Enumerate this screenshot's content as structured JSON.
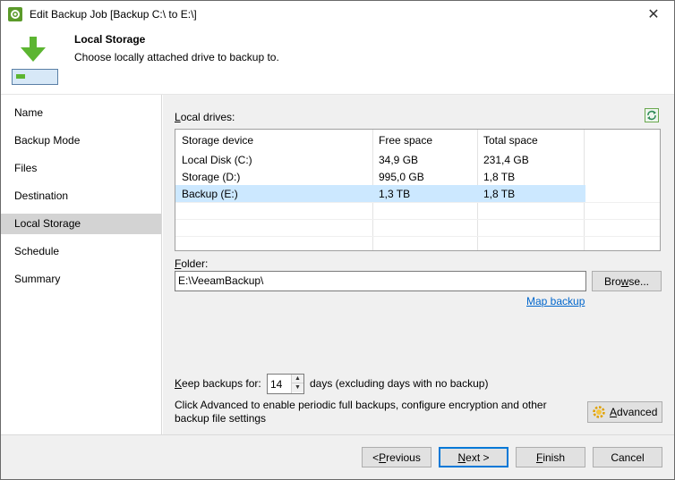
{
  "window": {
    "title": "Edit Backup Job [Backup C:\\ to E:\\]",
    "close_label": "✕"
  },
  "header": {
    "title": "Local Storage",
    "description": "Choose locally attached drive to backup to."
  },
  "sidebar": {
    "items": [
      {
        "label": "Name"
      },
      {
        "label": "Backup Mode"
      },
      {
        "label": "Files"
      },
      {
        "label": "Destination"
      },
      {
        "label": "Local Storage",
        "active": true
      },
      {
        "label": "Schedule"
      },
      {
        "label": "Summary"
      }
    ]
  },
  "drives": {
    "label_pre": "L",
    "label_post": "ocal drives:",
    "columns": [
      "Storage device",
      "Free space",
      "Total space"
    ],
    "rows": [
      [
        "Local Disk (C:)",
        "34,9 GB",
        "231,4 GB"
      ],
      [
        "Storage (D:)",
        "995,0 GB",
        "1,8 TB"
      ],
      [
        "Backup (E:)",
        "1,3 TB",
        "1,8 TB"
      ]
    ],
    "selected_row": 2
  },
  "folder": {
    "label_pre": "F",
    "label_post": "older:",
    "value": "E:\\VeeamBackup\\",
    "browse_pre": "Bro",
    "browse_u": "w",
    "browse_post": "se...",
    "map_link": "Map backup"
  },
  "retention": {
    "label_pre": "K",
    "label_post": "eep backups for:",
    "value": "14",
    "suffix": "days (excluding days with no backup)"
  },
  "advanced": {
    "info": "Click Advanced to enable periodic full backups, configure encryption and other backup file settings",
    "button_u": "A",
    "button_post": "dvanced"
  },
  "footer": {
    "previous_pre": "< ",
    "previous_u": "P",
    "previous_post": "revious",
    "next_u": "N",
    "next_post": "ext >",
    "finish_u": "F",
    "finish_post": "inish",
    "cancel_label": "Cancel"
  },
  "colors": {
    "accent": "#0078d7",
    "selected_row": "#cce8ff",
    "link": "#0066cc",
    "icon_green": "#5b9a2a"
  }
}
